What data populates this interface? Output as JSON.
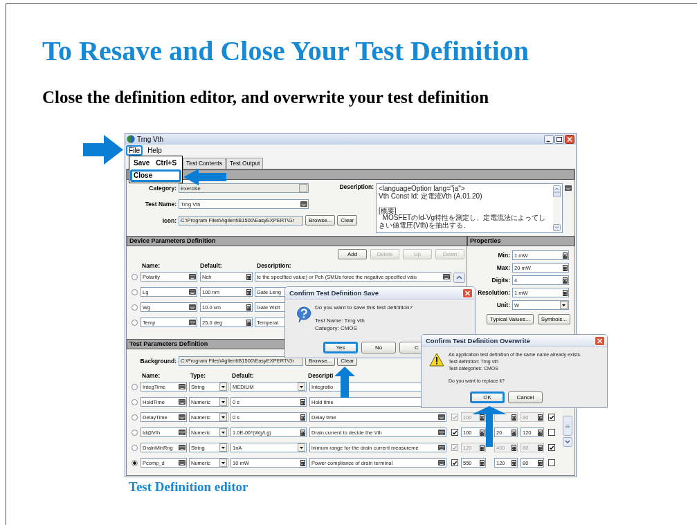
{
  "slide": {
    "title": "To Resave and Close Your Test Definition",
    "subtitle": "Close the definition editor, and overwrite your test definition",
    "caption": "Test Definition editor"
  },
  "window": {
    "title": "Trng Vth"
  },
  "menu": [
    {
      "label": "File",
      "highlighted": true
    },
    {
      "label": "Help",
      "highlighted": false
    }
  ],
  "file_menu": [
    {
      "label": "Save",
      "shortcut": "Ctrl+S",
      "highlighted": false
    },
    {
      "label": "Close",
      "highlighted": true
    }
  ],
  "tabs": [
    {
      "label": "Test Contents",
      "selected": false
    },
    {
      "label": "Test Output",
      "selected": false
    }
  ],
  "general": {
    "category_label": "Category:",
    "category": "Exercise",
    "test_name_label": "Test Name:",
    "test_name": "Trng Vth",
    "icon_label": "Icon:",
    "icon_path": "C:\\Program Files\\Agilent\\B1500\\EasyEXPERT\\Gr",
    "browse": "Browse...",
    "clear": "Clear",
    "description_label": "Description:",
    "description": "<languageOption lang=\"ja\">\nVth Const Id: 定電流Vth (A.01.20)\n\n[概要]\n  MOSFETのId-Vg特性を測定し、定電流法によってしきい値電圧(Vth)を抽出する。"
  },
  "device_parameters": {
    "title": "Device Parameters Definition",
    "buttons": [
      {
        "label": "Add",
        "disabled": false
      },
      {
        "label": "Delete",
        "disabled": true
      },
      {
        "label": "Up",
        "disabled": true
      },
      {
        "label": "Down",
        "disabled": true
      }
    ],
    "columns": [
      "Name:",
      "Default:",
      "Description:"
    ],
    "rows": [
      {
        "name": "Polarity",
        "default": "Nch",
        "description": "te the specified value) or Pch (SMUs force the negative specified valu",
        "selected": false
      },
      {
        "name": "Lg",
        "default": "100 nm",
        "description": "Gate Leng",
        "selected": false
      },
      {
        "name": "Wg",
        "default": "10.0 um",
        "description": "Gate Widt",
        "selected": false
      },
      {
        "name": "Temp",
        "default": "25.0 deg",
        "description": "Temperat",
        "selected": false
      }
    ]
  },
  "properties": {
    "title": "Properties",
    "fields": [
      {
        "label": "Min:",
        "value": "1 mW",
        "kind": "numeric"
      },
      {
        "label": "Max:",
        "value": "20 mW",
        "kind": "numeric"
      },
      {
        "label": "Digits:",
        "value": "4",
        "kind": "numeric"
      },
      {
        "label": "Resolution:",
        "value": "1 mW",
        "kind": "numeric"
      },
      {
        "label": "Unit:",
        "value": "W",
        "kind": "list"
      }
    ],
    "buttons": [
      "Typical Values...",
      "Symbols..."
    ]
  },
  "test_parameters": {
    "title": "Test Parameters Definition",
    "background_label": "Background:",
    "background": "C:\\Program Files\\Agilent\\B1500\\EasyEXPERT\\Gr",
    "browse": "Browse...",
    "clear": "Clear",
    "columns": [
      "Name:",
      "Type:",
      "Default:",
      "Descripti"
    ],
    "rows": [
      {
        "name": "IntegTime",
        "type": "String",
        "default": "MEDIUM",
        "kind": "list",
        "description": "Integratio",
        "selected": false
      },
      {
        "name": "HoldTime",
        "type": "Numeric",
        "default": "0 s",
        "kind": "numeric",
        "description": "Hold time",
        "selected": false
      },
      {
        "name": "DelayTime",
        "type": "Numeric",
        "default": "0 s",
        "kind": "numeric",
        "description": "Delay time",
        "selected": false,
        "limits": {
          "enabled": false,
          "checked": true,
          "value_1": "100",
          "value_3": "80",
          "flag": true
        }
      },
      {
        "name": "Id@Vth",
        "type": "Numeric",
        "default": "1.0E-06*(Wg/Lg)",
        "kind": "numeric",
        "description": "Drain current to decide the Vth",
        "selected": false,
        "limits": {
          "enabled": true,
          "checked": true,
          "value_1": "100",
          "value_2": "20",
          "value_3": "120",
          "flag": false
        }
      },
      {
        "name": "DrainMinRng",
        "type": "String",
        "default": "1nA",
        "kind": "list",
        "description": "inimum range for the drain current measureme",
        "selected": false,
        "limits": {
          "enabled": false,
          "checked": true,
          "value_1": "120",
          "value_2": "400",
          "value_3": "80",
          "flag": true
        }
      },
      {
        "name": "Pcomp_d",
        "type": "Numeric",
        "default": "10 mW",
        "kind": "numeric",
        "description": "Power compliance of drain terminal",
        "selected": true,
        "limits": {
          "enabled": true,
          "checked": true,
          "value_1": "550",
          "value_2": "120",
          "value_3": "80",
          "flag": false
        }
      }
    ]
  },
  "save_dialog": {
    "kind": "question",
    "title": "Confirm Test Definition Save",
    "paragraphs": [
      [
        "Do you want to save this test definition?"
      ],
      [
        "Test Name: Trng vth",
        "Category: CMOS"
      ]
    ],
    "buttons": [
      {
        "label": "Yes",
        "highlighted": true
      },
      {
        "label": "No",
        "highlighted": false
      },
      {
        "label": "C",
        "highlighted": false
      }
    ]
  },
  "overwrite_dialog": {
    "kind": "warning",
    "title": "Confirm Test Definition Overwrite",
    "paragraphs": [
      [
        "An application test definition of the same name already exists.",
        "Test definition: Trng vth",
        "Test categories: CMOS"
      ],
      [
        "Do you want to replace it?"
      ]
    ],
    "buttons": [
      {
        "label": "OK",
        "highlighted": true
      },
      {
        "label": "Cancel",
        "highlighted": false
      }
    ]
  }
}
